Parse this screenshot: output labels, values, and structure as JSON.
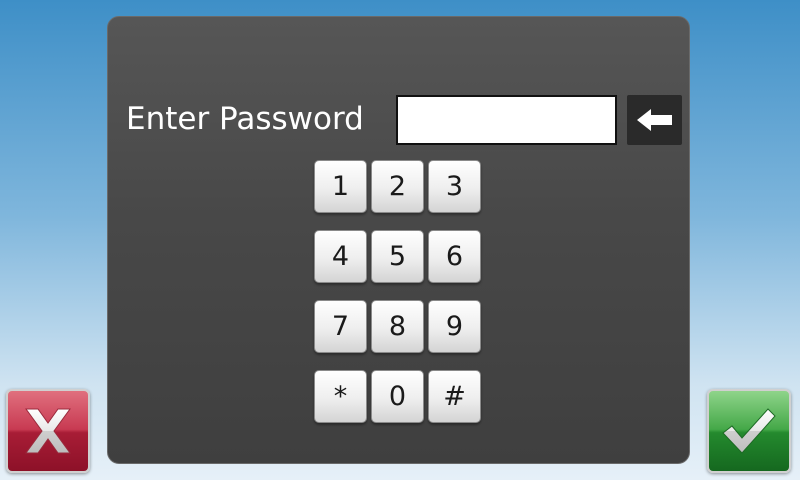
{
  "dialog": {
    "prompt": "Enter Password",
    "password_value": ""
  },
  "keypad": {
    "keys": [
      "1",
      "2",
      "3",
      "4",
      "5",
      "6",
      "7",
      "8",
      "9",
      "*",
      "0",
      "#"
    ]
  },
  "icons": {
    "backspace": "left-arrow-icon",
    "cancel": "x-icon",
    "confirm": "checkmark-icon"
  },
  "colors": {
    "cancel_red": "#b82440",
    "confirm_green": "#2c9436",
    "panel_gray": "#4a4a4a"
  }
}
